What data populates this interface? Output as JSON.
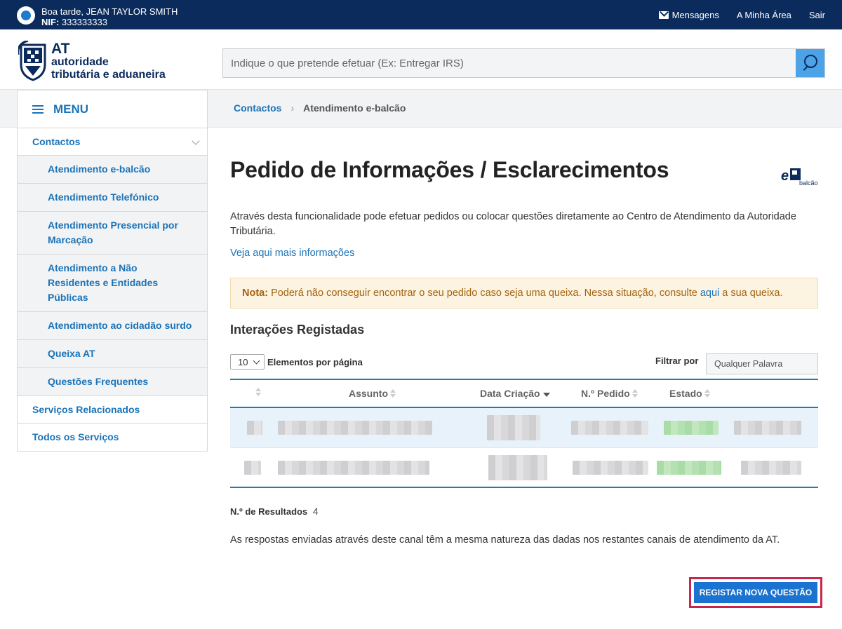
{
  "topbar": {
    "greeting": "Boa tarde, JEAN TAYLOR SMITH",
    "nif_label": "NIF:",
    "nif_value": "333333333",
    "links": {
      "messages": "Mensagens",
      "my_area": "A Minha Área",
      "exit": "Sair"
    }
  },
  "logo": {
    "line1": "AT",
    "line2": "autoridade",
    "line3": "tributária e aduaneira"
  },
  "search": {
    "placeholder": "Indique o que pretende efetuar (Ex: Entregar IRS)"
  },
  "sidebar": {
    "menu_label": "MENU",
    "items": [
      {
        "label": "Contactos",
        "level": "top"
      },
      {
        "label": "Atendimento e-balcão",
        "level": "sub"
      },
      {
        "label": "Atendimento Telefónico",
        "level": "sub"
      },
      {
        "label": "Atendimento Presencial por Marcação",
        "level": "sub"
      },
      {
        "label": "Atendimento a Não Residentes e Entidades Públicas",
        "level": "sub"
      },
      {
        "label": "Atendimento ao cidadão surdo",
        "level": "sub"
      },
      {
        "label": "Queixa AT",
        "level": "sub"
      },
      {
        "label": "Questões Frequentes",
        "level": "sub"
      },
      {
        "label": "Serviços Relacionados",
        "level": "top"
      },
      {
        "label": "Todos os Serviços",
        "level": "top"
      }
    ]
  },
  "breadcrumb": {
    "item1": "Contactos",
    "separator": "›",
    "item2": "Atendimento e-balcão"
  },
  "main": {
    "title": "Pedido de Informações / Esclarecimentos",
    "ebalcao_badge": "balcão",
    "description": "Através desta funcionalidade pode efetuar pedidos ou colocar questões diretamente ao Centro de Atendimento da Autoridade Tributária.",
    "more_info_link": "Veja aqui mais informações",
    "note": {
      "label": "Nota:",
      "text_before": "Poderá não conseguir encontrar o seu pedido caso seja uma queixa. Nessa situação, consulte",
      "link": "aqui",
      "text_after": "a sua queixa."
    },
    "section_title": "Interações Registadas",
    "page_size": "10",
    "page_size_label": "Elementos por página",
    "filter_label": "Filtrar por",
    "filter_placeholder": "Qualquer Palavra",
    "table": {
      "columns": [
        "Assunto",
        "Data Criação",
        "N.º Pedido",
        "Estado"
      ]
    },
    "results_label": "N.º de Resultados",
    "results_count": "4",
    "footer_text": "As respostas enviadas através deste canal têm a mesma natureza das dadas nos restantes canais de atendimento da AT.",
    "new_question_button": "REGISTAR NOVA QUESTÃO"
  },
  "colors": {
    "topbar": "#0b2b5c",
    "link": "#1a73b8",
    "note_bg": "#fcf3e1",
    "note_text": "#a5620e",
    "primary_button": "#1a73d0",
    "highlight_border": "#c8254f"
  }
}
